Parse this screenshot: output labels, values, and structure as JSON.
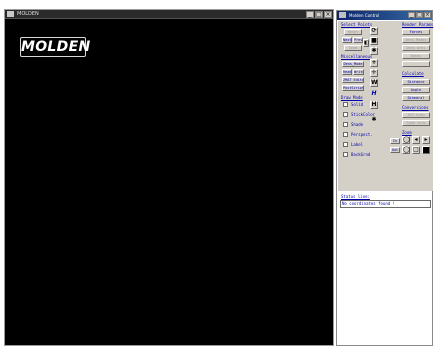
{
  "main_window": {
    "title": "MOLDEN",
    "logo_text": "MOLDEN",
    "min_glyph": "_",
    "max_glyph": "□",
    "close_glyph": "×"
  },
  "control_window": {
    "title": "Molden Control",
    "min_glyph": "_",
    "max_glyph": "□",
    "close_glyph": "×"
  },
  "sections": {
    "select_points": "Select Points",
    "render_params": "Render Params",
    "miscellaneous": "Miscellaneous",
    "calculate": "Calculate",
    "draw_mode": "Draw Mode",
    "conversions": "Conversions",
    "zoom": "Zoom"
  },
  "buttons": {
    "reset": "Reset",
    "next": "Next",
    "prev": "Prev",
    "forces": "Forces",
    "dens_modes": "Dens Modes",
    "dens_orbs": "Dens Orbs",
    "geom": "Geom",
    "bonds": "Bonds",
    "dens_mode": "Dens_Mode",
    "read": "Read",
    "write": "Write",
    "zmat_editor": "ZMAT Editor",
    "distance": "Distance",
    "postscript": "PostScript",
    "angle": "Angle",
    "dihedral": "Dihedral",
    "xyz_view": "XYZ View",
    "symm_info": "Symm Info"
  },
  "icons": {
    "rotate": "⟳",
    "select": "■",
    "flag": "◧",
    "plus": "+",
    "move": "✛",
    "hbond": "H",
    "label_h": "H",
    "mark": "✱",
    "w": "W"
  },
  "checkboxes": [
    {
      "label": "Solid"
    },
    {
      "label": "StickColor"
    },
    {
      "label": "Shade"
    },
    {
      "label": "Perspect."
    },
    {
      "label": "Label"
    },
    {
      "label": "BackGrnd"
    }
  ],
  "zoom": {
    "in": "In",
    "out": "Out"
  },
  "status": {
    "label": "Status line:",
    "text": "No coordinates found !"
  }
}
